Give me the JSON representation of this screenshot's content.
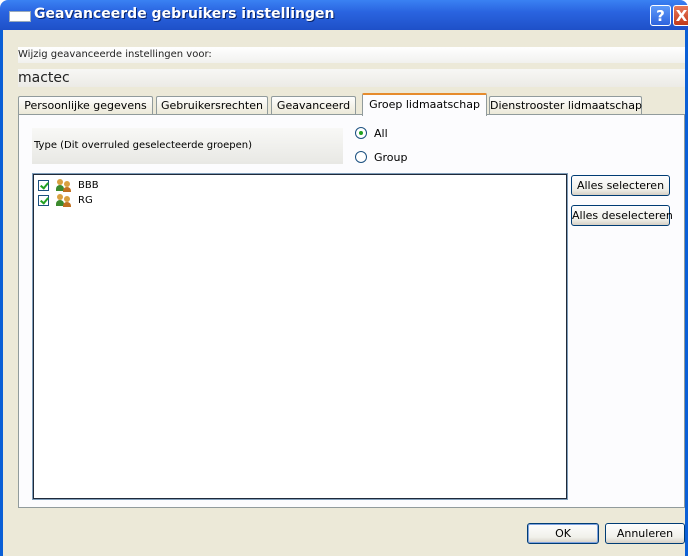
{
  "window": {
    "title": "Geavanceerde gebruikers instellingen",
    "help_glyph": "?",
    "close_glyph": "X"
  },
  "header": {
    "modify_label": "Wijzig geavanceerde instellingen voor:",
    "user_name": "mactec"
  },
  "tabs": [
    {
      "label": "Persoonlijke gegevens"
    },
    {
      "label": "Gebruikersrechten"
    },
    {
      "label": "Geavanceerd"
    },
    {
      "label": "Groep lidmaatschap",
      "active": true
    },
    {
      "label": "Dienstrooster lidmaatschap"
    }
  ],
  "type_section": {
    "label": "Type (Dit overruled geselecteerde groepen)",
    "options": [
      {
        "label": "All",
        "checked": true
      },
      {
        "label": "Group",
        "checked": false
      }
    ]
  },
  "groups": [
    {
      "label": "BBB",
      "checked": true,
      "icon": "group-icon"
    },
    {
      "label": "RG",
      "checked": true,
      "icon": "group-icon"
    }
  ],
  "side_buttons": {
    "select_all": "Alles selecteren",
    "deselect_all": "Alles deselecteren"
  },
  "footer": {
    "ok": "OK",
    "cancel": "Annuleren"
  },
  "colors": {
    "titlebar": "#2a64e0",
    "dialog_bg": "#ece9d8",
    "active_tab_accent": "#e68b2c"
  }
}
